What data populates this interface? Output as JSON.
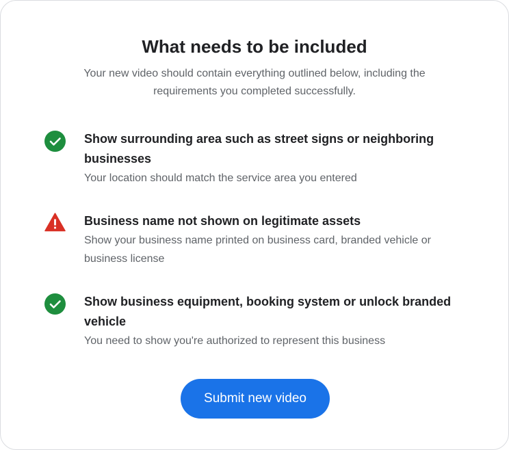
{
  "header": {
    "title": "What needs to be included",
    "subtitle": "Your new video should contain everything outlined below, including the requirements you completed successfully."
  },
  "requirements": [
    {
      "status": "completed",
      "icon": "check-circle-icon",
      "heading": "Show surrounding area such as street signs or neighboring businesses",
      "description": "Your location should match the service area you entered"
    },
    {
      "status": "missing",
      "icon": "warning-triangle-icon",
      "heading": "Business name not shown on legitimate assets",
      "description": "Show your business name printed on business card, branded vehicle or business license"
    },
    {
      "status": "completed",
      "icon": "check-circle-icon",
      "heading": "Show business equipment, booking system or unlock branded vehicle",
      "description": "You need to show you're authorized to represent this business"
    }
  ],
  "actions": {
    "submit_label": "Submit new video"
  },
  "colors": {
    "success": "#1e8e3e",
    "warning": "#d93025",
    "primary": "#1a73e8",
    "text_primary": "#202124",
    "text_secondary": "#5f6368"
  }
}
